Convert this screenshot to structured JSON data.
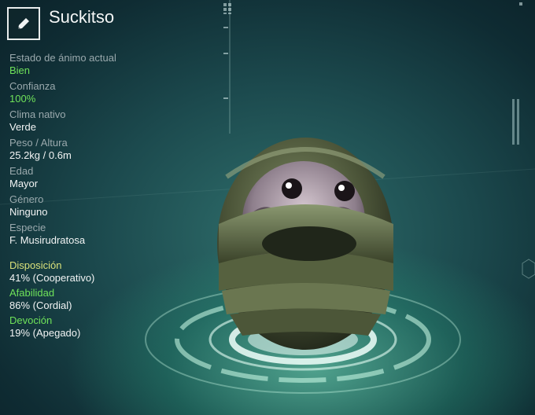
{
  "header": {
    "creature_name": "Suckitso",
    "edit_icon": "pencil-icon"
  },
  "stats": [
    {
      "label": "Estado de ánimo actual",
      "value": "Bien",
      "value_color": "#6fe25a"
    },
    {
      "label": "Confianza",
      "value": "100%",
      "value_color": "#6fe25a"
    },
    {
      "label": "Clima nativo",
      "value": "Verde"
    },
    {
      "label": "Peso / Altura",
      "value": "25.2kg / 0.6m"
    },
    {
      "label": "Edad",
      "value": "Mayor"
    },
    {
      "label": "Género",
      "value": "Ninguno"
    },
    {
      "label": "Especie",
      "value": "F. Musirudratosa"
    }
  ],
  "traits": [
    {
      "label": "Disposición",
      "value": "41% (Cooperativo)",
      "label_color": "#d9e07a"
    },
    {
      "label": "Afabilidad",
      "value": "86% (Cordial)",
      "label_color": "#6fe25a"
    },
    {
      "label": "Devoción",
      "value": "19% (Apegado)",
      "label_color": "#6fe25a"
    }
  ]
}
